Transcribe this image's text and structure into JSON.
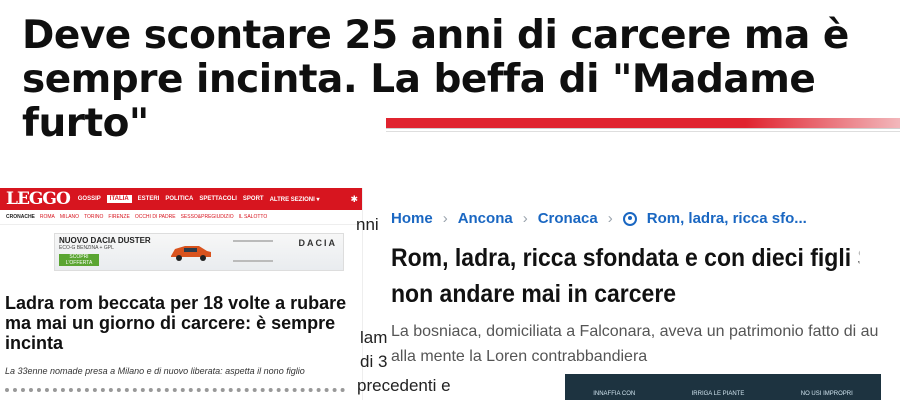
{
  "headline": "Deve scontare 25 anni di carcere ma è sempre incinta. La beffa di \"Madame furto\"",
  "leggo": {
    "logo": "LEGGO",
    "nav": [
      "GOSSIP",
      "ITALIA",
      "ESTERI",
      "POLITICA",
      "SPETTACOLI",
      "SPORT",
      "ALTRE SEZIONI ▾"
    ],
    "nav_active": "ITALIA",
    "sub": [
      "CRONACHE",
      "ROMA",
      "MILANO",
      "TORINO",
      "FIRENZE",
      "OCCHI DI PADRE",
      "SESSO&PREGIUDIZIO",
      "IL SALOTTO"
    ],
    "ad": {
      "title": "NUOVO DACIA DUSTER",
      "sub": "ECO-G BENZINA + GPL",
      "cta": "SCOPRI L'OFFERTA",
      "brand": "DACIA"
    },
    "title": "Ladra rom beccata per 18 volte a rubare ma mai un giorno di carcere: è sempre incinta",
    "summary": "La 33enne nomade presa a Milano e di nuovo liberata: aspetta il nono figlio"
  },
  "fragments": [
    "nni",
    "lam",
    "di 3",
    "precedenti e"
  ],
  "article": {
    "breadcrumb": [
      "Home",
      "Ancona",
      "Cronaca",
      "Rom, ladra, ricca sfo..."
    ],
    "title_lines": [
      "Rom, ladra, ricca sfondata e con dieci figli S",
      "non andare mai in carcere"
    ],
    "lead_lines": [
      "La bosniaca, domiciliata a Falconara, aveva un patrimonio fatto di au",
      "alla mente la Loren contrabbandiera"
    ]
  },
  "media_bar": [
    "INNAFFIA CON",
    "IRRIGA LE PIANTE",
    "NO USI IMPROPRI"
  ],
  "colors": {
    "accent": "#e0242f",
    "leggo_red": "#d7151f",
    "link_blue": "#1a67c2"
  }
}
